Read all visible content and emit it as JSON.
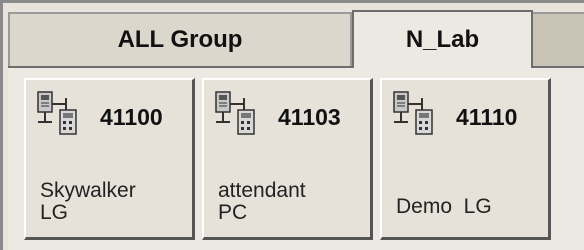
{
  "tabs": [
    {
      "label": "ALL Group",
      "active": false
    },
    {
      "label": "N_Lab",
      "active": true
    }
  ],
  "devices": [
    {
      "number": "41100",
      "label": "Skywalker\nLG",
      "icon": "network-phone-icon"
    },
    {
      "number": "41103",
      "label": "attendant\nPC",
      "icon": "network-phone-icon"
    },
    {
      "number": "41110",
      "label": "Demo  LG",
      "icon": "network-phone-icon"
    }
  ]
}
